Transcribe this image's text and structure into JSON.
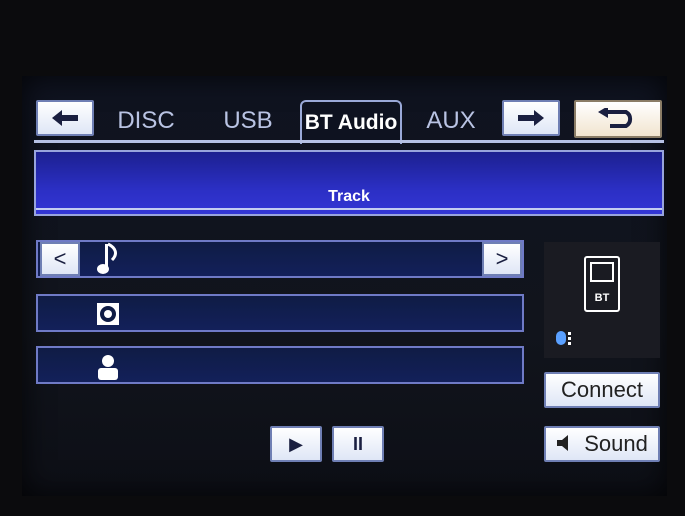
{
  "tabs": [
    {
      "label": "DISC"
    },
    {
      "label": "USB"
    },
    {
      "label": "BT Audio",
      "active": true
    },
    {
      "label": "AUX"
    }
  ],
  "track": {
    "label": "Track"
  },
  "phone": {
    "badge": "BT"
  },
  "buttons": {
    "connect": "Connect",
    "sound": "Sound",
    "prev_glyph": "<",
    "next_glyph": ">",
    "play_glyph": "▶",
    "pause_glyph": "II"
  },
  "icons": {
    "left_arrow": "left-arrow-icon",
    "right_arrow": "right-arrow-icon",
    "back": "return-icon",
    "song": "music-note-icon",
    "album": "disc-icon",
    "artist": "person-icon",
    "bluetooth": "bluetooth-icon",
    "speaker": "speaker-icon"
  },
  "colors": {
    "track_bar": "#2b2fc4",
    "row_border": "#6f7ac6",
    "tab_active_text": "#ffffff",
    "tab_inactive_text": "#b9c3e3"
  }
}
